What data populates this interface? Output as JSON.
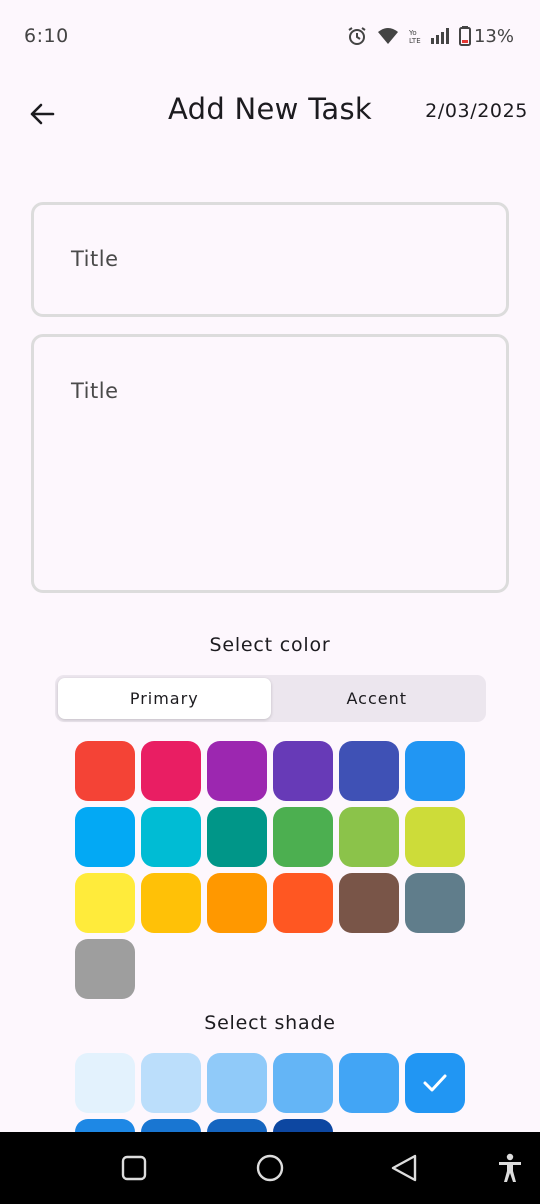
{
  "status_bar": {
    "time": "6:10",
    "battery": "13%",
    "icons": [
      "alarm-icon",
      "wifi-icon",
      "volte-icon",
      "signal-icon",
      "battery-icon"
    ]
  },
  "app_bar": {
    "back_icon": "arrow-left-icon",
    "title": "Add New Task",
    "date": "2/03/2025"
  },
  "form": {
    "title_placeholder": "Title",
    "description_placeholder": "Title"
  },
  "color_section": {
    "label": "Select color",
    "tabs": [
      {
        "label": "Primary",
        "selected": true
      },
      {
        "label": "Accent",
        "selected": false
      }
    ],
    "colors": [
      "#f44336",
      "#e91e63",
      "#9c27b0",
      "#673ab7",
      "#3f51b5",
      "#2196f3",
      "#03a9f4",
      "#00bcd4",
      "#009688",
      "#4caf50",
      "#8bc34a",
      "#cddc39",
      "#ffeb3b",
      "#ffc107",
      "#ff9800",
      "#ff5722",
      "#795548",
      "#607d8b",
      "#9e9e9e"
    ]
  },
  "shade_section": {
    "label": "Select shade",
    "shades": [
      "#e3f2fd",
      "#bbdefb",
      "#90caf9",
      "#64b5f6",
      "#42a5f5",
      "#2196f3",
      "#1e88e5",
      "#1976d2",
      "#1565c0",
      "#0d47a1"
    ],
    "selected_index": 5,
    "check_icon": "check-icon"
  },
  "nav_bar": {
    "icons": [
      "recent-apps-icon",
      "home-icon",
      "back-icon",
      "accessibility-icon"
    ]
  }
}
